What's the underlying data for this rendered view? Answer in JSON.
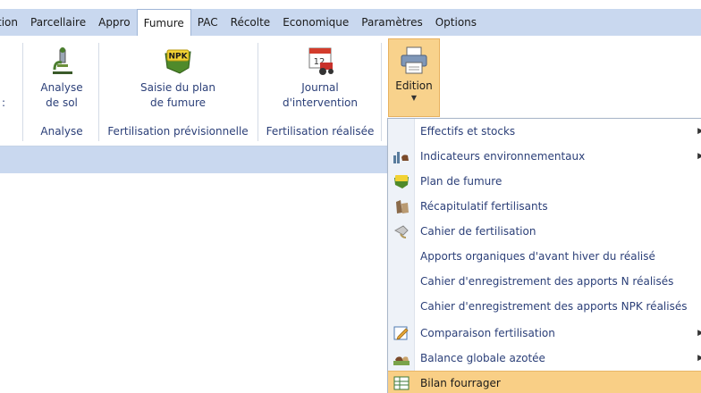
{
  "menubar": {
    "tabs": [
      {
        "label": "tion"
      },
      {
        "label": "Parcellaire"
      },
      {
        "label": "Appro"
      },
      {
        "label": "Fumure"
      },
      {
        "label": "PAC"
      },
      {
        "label": "Récolte"
      },
      {
        "label": "Economique"
      },
      {
        "label": "Paramètres"
      },
      {
        "label": "Options"
      }
    ],
    "active_tab": "Fumure"
  },
  "ribbon": {
    "left_stub": ":",
    "buttons": {
      "analyse_sol": {
        "line1": "Analyse",
        "line2": "de sol",
        "icon": "microscope-icon"
      },
      "saisie_plan": {
        "line1": "Saisie du plan",
        "line2": "de fumure",
        "icon": "npk-icon"
      },
      "journal": {
        "line1": "Journal",
        "line2": "d'intervention",
        "icon": "calendar-tractor-icon"
      },
      "edition": {
        "label": "Edition",
        "icon": "printer-icon"
      }
    },
    "groups": {
      "analyse": "Analyse",
      "previsionnelle": "Fertilisation prévisionnelle",
      "realisee": "Fertilisation réalisée"
    }
  },
  "dropdown": {
    "items": [
      {
        "label": "Effectifs et stocks",
        "icon": "",
        "submenu": true
      },
      {
        "label": "Indicateurs environnementaux",
        "icon": "cattle-chart-icon",
        "submenu": true
      },
      {
        "label": "Plan de fumure",
        "icon": "npk-icon",
        "submenu": false
      },
      {
        "label": "Récapitulatif fertilisants",
        "icon": "fertilizer-sack-icon",
        "submenu": false
      },
      {
        "label": "Cahier de fertilisation",
        "icon": "spreader-icon",
        "submenu": false
      },
      {
        "label": "Apports organiques d'avant hiver du réalisé",
        "icon": "",
        "submenu": false
      },
      {
        "label": "Cahier d'enregistrement des apports N réalisés",
        "icon": "",
        "submenu": false
      },
      {
        "label": "Cahier d'enregistrement des apports NPK réalisés",
        "icon": "",
        "submenu": false
      },
      {
        "label": "Comparaison fertilisation",
        "icon": "edit-pencil-icon",
        "submenu": true
      },
      {
        "label": "Balance globale azotée",
        "icon": "cattle-field-icon",
        "submenu": true
      },
      {
        "label": "Bilan fourrager",
        "icon": "forage-table-icon",
        "submenu": false
      }
    ]
  }
}
